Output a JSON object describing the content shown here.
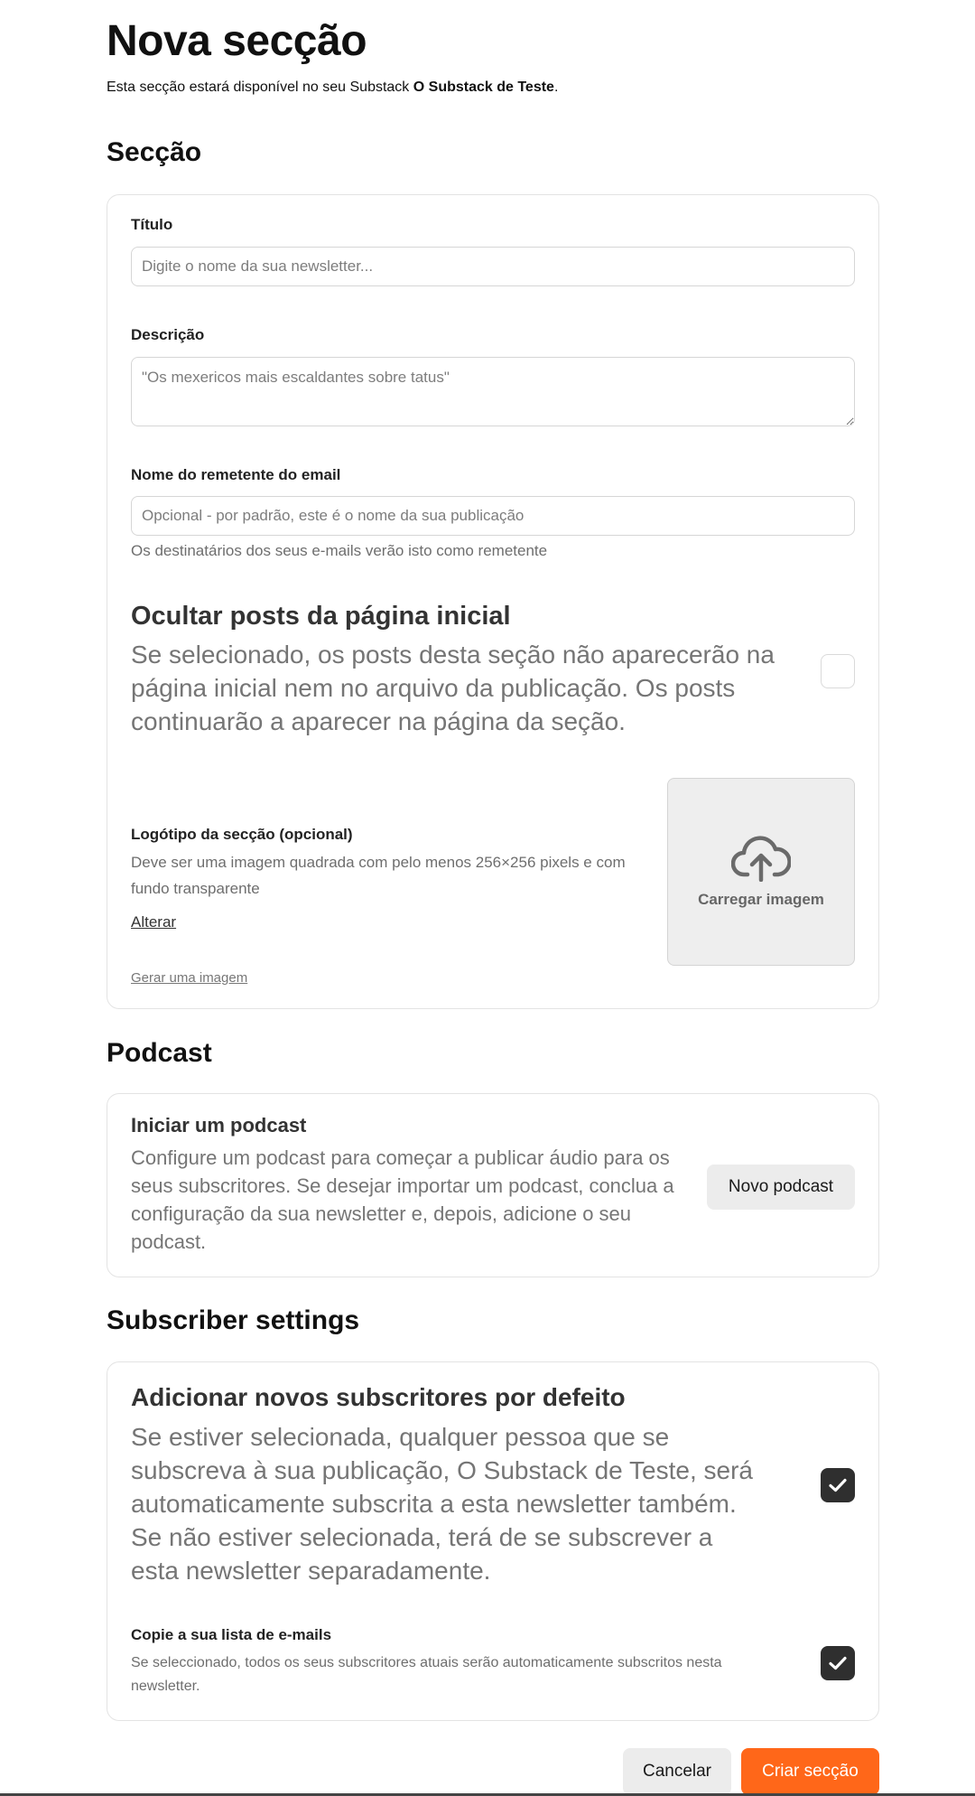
{
  "header": {
    "title": "Nova secção",
    "subtitle_prefix": "Esta secção estará disponível no seu Substack ",
    "publication_name": "O Substack de Teste",
    "subtitle_suffix": "."
  },
  "section": {
    "heading": "Secção",
    "title_label": "Título",
    "title_placeholder": "Digite o nome da sua newsletter...",
    "description_label": "Descrição",
    "description_placeholder": "\"Os mexericos mais escaldantes sobre tatus\"",
    "sender_label": "Nome do remetente do email",
    "sender_placeholder": "Opcional - por padrão, este é o nome da sua publicação",
    "sender_help": "Os destinatários dos seus e-mails verão isto como remetente",
    "hide_posts_title": "Ocultar posts da página inicial",
    "hide_posts_desc": "Se selecionado, os posts desta seção não aparecerão na página inicial nem no arquivo da publicação. Os posts continuarão a aparecer na página da seção.",
    "hide_posts_checked": false,
    "logo_label": "Logótipo da secção (opcional)",
    "logo_desc": "Deve ser uma imagem quadrada com pelo menos 256×256 pixels e com fundo transparente",
    "logo_change": "Alterar",
    "logo_generate": "Gerar uma imagem",
    "upload_label": "Carregar imagem",
    "upload_icon": "cloud-upload-icon"
  },
  "podcast": {
    "heading": "Podcast",
    "title": "Iniciar um podcast",
    "desc": "Configure um podcast para começar a publicar áudio para os seus subscritores. Se desejar importar um podcast, conclua a configuração da sua newsletter e, depois, adicione o seu podcast.",
    "button": "Novo podcast"
  },
  "subscriber": {
    "heading": "Subscriber settings",
    "add_title": "Adicionar novos subscritores por defeito",
    "add_desc": "Se estiver selecionada, qualquer pessoa que se subscreva à sua publicação, O Substack de Teste, será automaticamente subscrita a esta newsletter também. Se não estiver selecionada, terá de se subscrever a esta newsletter separadamente.",
    "add_checked": true,
    "copy_title": "Copie a sua lista de e-mails",
    "copy_desc": "Se seleccionado, todos os seus subscritores atuais serão automaticamente subscritos nesta newsletter.",
    "copy_checked": true
  },
  "footer": {
    "cancel": "Cancelar",
    "create": "Criar secção"
  },
  "colors": {
    "accent": "#ff6719",
    "checkbox_checked": "#2f2f2f"
  }
}
